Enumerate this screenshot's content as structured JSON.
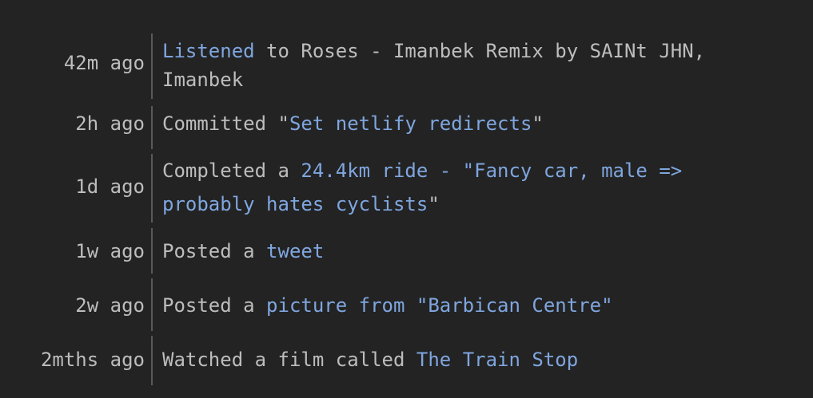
{
  "feed": {
    "items": [
      {
        "time": "42m ago",
        "prefix": "",
        "link": "Listened",
        "middle": " to Roses - Imanbek Remix by SAINt JHN,\nImanbek",
        "link2": "",
        "suffix": ""
      },
      {
        "time": "2h ago",
        "prefix": "Committed \"",
        "link": "Set netlify redirects",
        "middle": "\"",
        "link2": "",
        "suffix": ""
      },
      {
        "time": "1d ago",
        "prefix": "Completed a ",
        "link": "24.4km ride - \"Fancy car, male =>\nprobably hates cyclists",
        "middle": "\"",
        "link2": "",
        "suffix": ""
      },
      {
        "time": "1w ago",
        "prefix": "Posted a ",
        "link": "tweet",
        "middle": "",
        "link2": "",
        "suffix": ""
      },
      {
        "time": "2w ago",
        "prefix": "Posted a ",
        "link": "picture from \"Barbican Centre\"",
        "middle": "",
        "link2": "",
        "suffix": ""
      },
      {
        "time": "2mths ago",
        "prefix": "Watched a film called ",
        "link": "The Train Stop",
        "middle": "",
        "link2": "",
        "suffix": ""
      }
    ]
  },
  "colors": {
    "background": "#232323",
    "text": "#bdbdbd",
    "link": "#7fa6df",
    "divider": "#5a5a5a"
  }
}
